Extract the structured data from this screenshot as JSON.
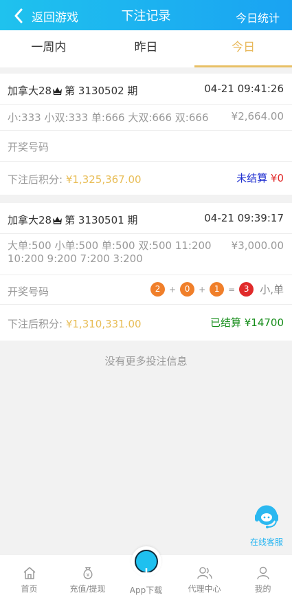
{
  "header": {
    "back_label": "返回游戏",
    "title": "下注记录",
    "right_label": "今日统计"
  },
  "tabs": [
    {
      "label": "一周内",
      "active": false
    },
    {
      "label": "昨日",
      "active": false
    },
    {
      "label": "今日",
      "active": true
    }
  ],
  "records": [
    {
      "game": "加拿大28",
      "issue": "第 3130502 期",
      "time": "04-21 09:41:26",
      "bet_detail": "小:333 小双:333 单:666 大双:666 双:666",
      "amount": "¥2,664.00",
      "draw_label": "开奖号码",
      "score_label": "下注后积分:",
      "score_value": "¥1,325,367.00",
      "status_label": "未结算",
      "status_amount": "¥0"
    },
    {
      "game": "加拿大28",
      "issue": "第 3130501 期",
      "time": "04-21 09:39:17",
      "bet_detail": "大单:500 小单:500 单:500 双:500 11:200 10:200 9:200 7:200 3:200",
      "amount": "¥3,000.00",
      "draw_label": "开奖号码",
      "balls": [
        "2",
        "0",
        "1"
      ],
      "ops": [
        "+",
        "+",
        "="
      ],
      "sum": "3",
      "result": "小,单",
      "score_label": "下注后积分:",
      "score_value": "¥1,310,331.00",
      "status_label": "已结算",
      "status_amount": "¥14700"
    }
  ],
  "no_more": "没有更多投注信息",
  "customer_service": "在线客服",
  "bottom_nav": [
    {
      "label": "首页",
      "icon": "home-icon"
    },
    {
      "label": "充值/提现",
      "icon": "money-bag-icon"
    },
    {
      "label": "App下载",
      "icon": "plus-icon"
    },
    {
      "label": "代理中心",
      "icon": "users-icon"
    },
    {
      "label": "我的",
      "icon": "user-icon"
    }
  ],
  "colors": {
    "header_gradient_start": "#1fc2ee",
    "header_gradient_end": "#1aa3f2",
    "active_tab": "#e8b85a",
    "score_gold": "#e8bd56",
    "unsettled_blue": "#1f2fd0",
    "settled_green": "#168d1a",
    "ball_orange": "#f07f2a",
    "ball_red": "#e02a2a"
  }
}
